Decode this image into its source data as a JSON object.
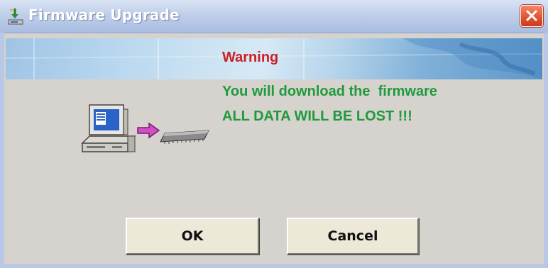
{
  "window": {
    "title": "Firmware Upgrade",
    "title_icon": "installer-icon",
    "close_icon": "close-icon"
  },
  "dialog": {
    "warning": "Warning",
    "message_line1": "You will download the  firmware",
    "message_line2": "ALL DATA WILL BE LOST !!!",
    "illustration_icons": [
      "computer-icon",
      "arrow-right-icon",
      "chip-icon"
    ]
  },
  "buttons": {
    "ok_label": "OK",
    "cancel_label": "Cancel"
  },
  "colors": {
    "titlebar": "#b0c2e4",
    "warning": "#cc1f26",
    "message": "#1f9a3c",
    "background": "#d6d3ce",
    "close_button": "#e45a35"
  }
}
